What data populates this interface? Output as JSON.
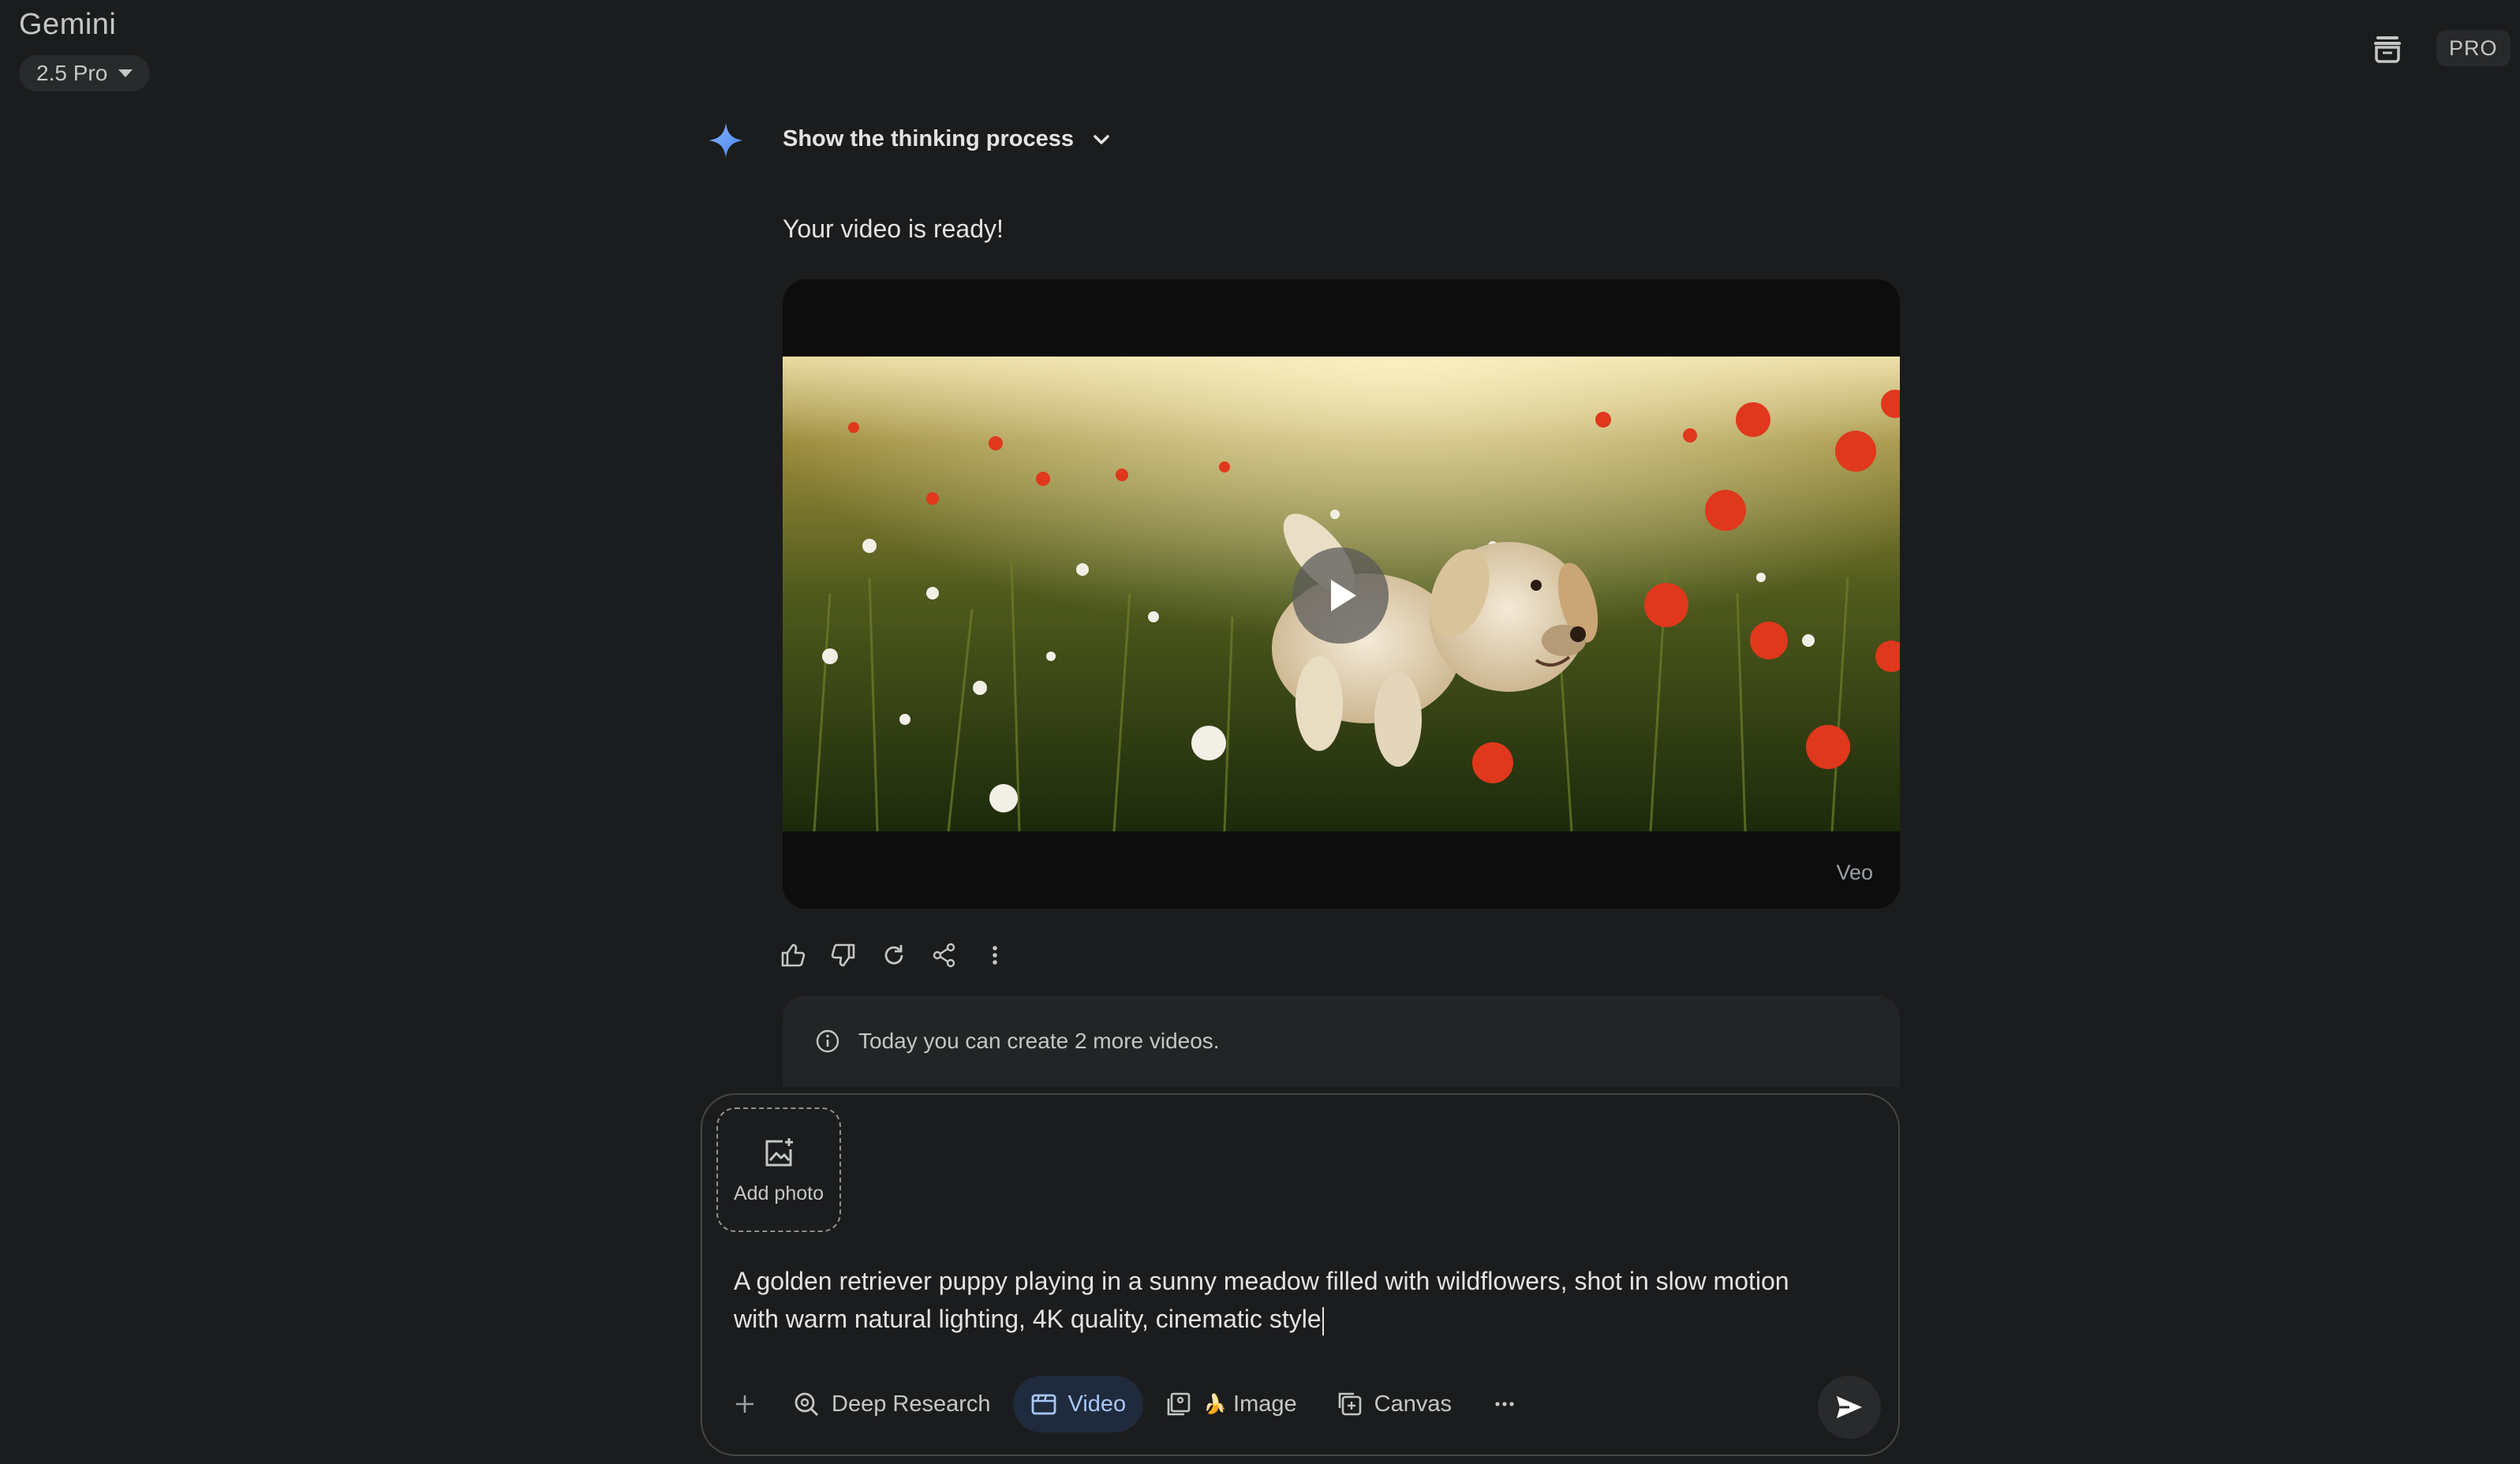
{
  "header": {
    "brand": "Gemini",
    "model_label": "2.5 Pro",
    "pro_badge": "PRO"
  },
  "response": {
    "thinking_label": "Show the thinking process",
    "message": "Your video is ready!",
    "video_watermark": "Veo"
  },
  "actions": [
    "thumb-up-icon",
    "thumb-down-icon",
    "refresh-icon",
    "share-icon",
    "more-vert-icon"
  ],
  "notice": {
    "text": "Today you can create 2 more videos."
  },
  "input": {
    "add_photo_label": "Add photo",
    "prompt_line1": "A golden retriever puppy playing in a sunny meadow filled with wildflowers, shot in slow motion",
    "prompt_line2": "with warm natural lighting, 4K quality, cinematic style",
    "tools": {
      "deep_research": "Deep Research",
      "video": "Video",
      "image_emoji": "🍌",
      "image": "Image",
      "canvas": "Canvas"
    }
  },
  "colors": {
    "background": "#1b1c1d",
    "accent": "#a8c7fa",
    "spark": "#4285f4"
  }
}
